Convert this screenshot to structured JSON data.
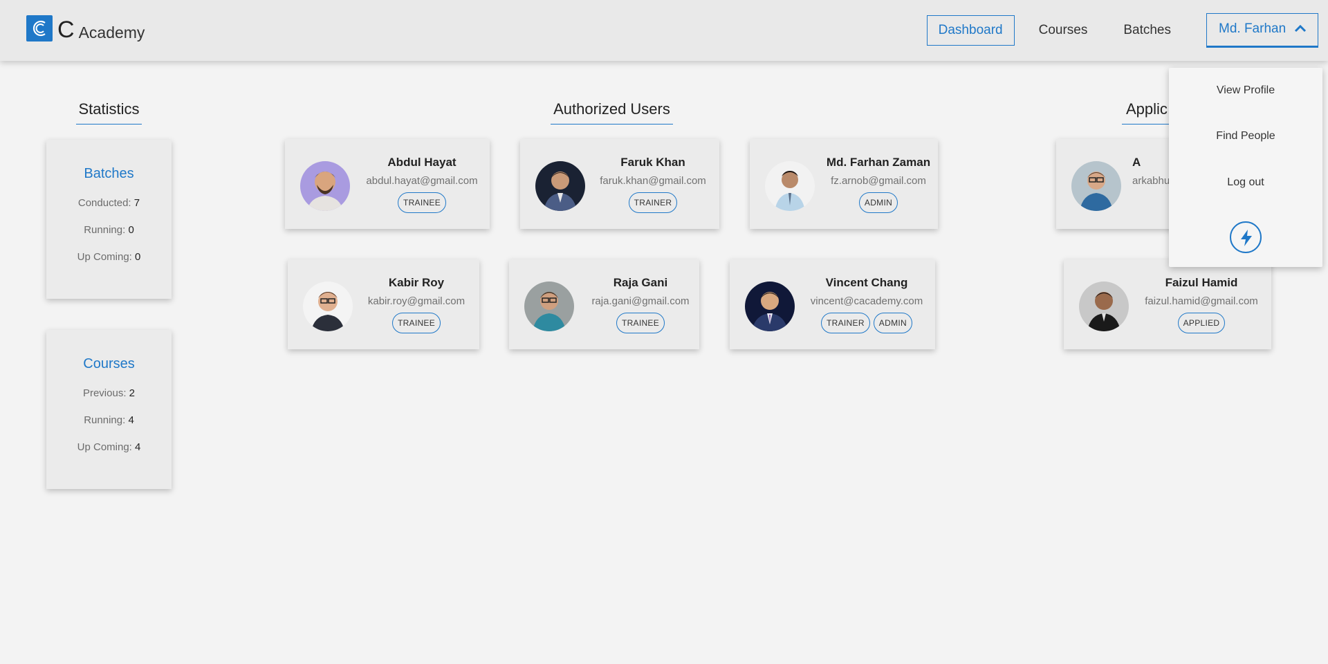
{
  "brand": {
    "letter": "C",
    "name": "Academy",
    "icon": "academy-logo-icon"
  },
  "nav": {
    "dashboard": "Dashboard",
    "courses": "Courses",
    "batches": "Batches",
    "user": "Md. Farhan",
    "user_chevron_icon": "chevron-up-icon"
  },
  "dropdown": {
    "items": [
      "View Profile",
      "Find People",
      "Log out"
    ],
    "bolt_icon": "lightning-bolt-icon"
  },
  "statistics": {
    "title": "Statistics",
    "batches": {
      "title": "Batches",
      "rows": [
        {
          "label": "Conducted:",
          "value": "7"
        },
        {
          "label": "Running:",
          "value": "0"
        },
        {
          "label": "Up Coming:",
          "value": "0"
        }
      ]
    },
    "courses": {
      "title": "Courses",
      "rows": [
        {
          "label": "Previous:",
          "value": "2"
        },
        {
          "label": "Running:",
          "value": "4"
        },
        {
          "label": "Up Coming:",
          "value": "4"
        }
      ]
    }
  },
  "authorized": {
    "title": "Authorized Users",
    "users": [
      {
        "name": "Abdul Hayat",
        "email": "abdul.hayat@gmail.com",
        "roles": [
          "TRAINEE"
        ]
      },
      {
        "name": "Faruk Khan",
        "email": "faruk.khan@gmail.com",
        "roles": [
          "TRAINER"
        ]
      },
      {
        "name": "Md. Farhan Zaman",
        "email": "fz.arnob@gmail.com",
        "roles": [
          "ADMIN"
        ]
      },
      {
        "name": "Kabir Roy",
        "email": "kabir.roy@gmail.com",
        "roles": [
          "TRAINEE"
        ]
      },
      {
        "name": "Raja Gani",
        "email": "raja.gani@gmail.com",
        "roles": [
          "TRAINEE"
        ]
      },
      {
        "name": "Vincent Chang",
        "email": "vincent@cacademy.com",
        "roles": [
          "TRAINER",
          "ADMIN"
        ]
      }
    ]
  },
  "applicants": {
    "title": "Applic",
    "users": [
      {
        "name": "A",
        "email": "arkabhu",
        "roles": []
      },
      {
        "name": "Faizul Hamid",
        "email": "faizul.hamid@gmail.com",
        "roles": [
          "APPLIED"
        ]
      }
    ]
  },
  "colors": {
    "accent": "#1f78c8",
    "background": "#f3f3f3",
    "card": "#ebebeb"
  }
}
